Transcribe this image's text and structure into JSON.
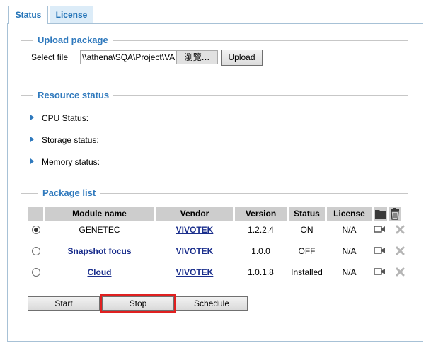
{
  "tabs": [
    {
      "label": "Status",
      "active": true
    },
    {
      "label": "License",
      "active": false
    }
  ],
  "upload": {
    "title": "Upload package",
    "select_label": "Select file",
    "file_value": "\\\\athena\\SQA\\Project\\VAI",
    "browse_label": "瀏覽...",
    "upload_label": "Upload"
  },
  "resource": {
    "title": "Resource status",
    "items": [
      {
        "label": "CPU Status:"
      },
      {
        "label": "Storage status:"
      },
      {
        "label": "Memory status:"
      }
    ]
  },
  "packages": {
    "title": "Package list",
    "columns": [
      "Module name",
      "Vendor",
      "Version",
      "Status",
      "License"
    ],
    "rows": [
      {
        "module": "GENETEC",
        "module_link": false,
        "vendor": "VIVOTEK",
        "version": "1.2.2.4",
        "status": "ON",
        "license": "N/A",
        "selected": true
      },
      {
        "module": "Snapshot focus",
        "module_link": true,
        "vendor": "VIVOTEK",
        "version": "1.0.0",
        "status": "OFF",
        "license": "N/A",
        "selected": false
      },
      {
        "module": "Cloud",
        "module_link": true,
        "vendor": "VIVOTEK",
        "version": "1.0.1.8",
        "status": "Installed",
        "license": "N/A",
        "selected": false
      }
    ],
    "header_icons": [
      "folder-icon",
      "trash-icon"
    ],
    "row_icons": [
      "camera-icon",
      "delete-x-icon"
    ]
  },
  "actions": {
    "start_label": "Start",
    "stop_label": "Stop",
    "schedule_label": "Schedule"
  },
  "colors": {
    "accent": "#2f79bd",
    "highlight": "#e02020",
    "link": "#1a2e8c"
  }
}
